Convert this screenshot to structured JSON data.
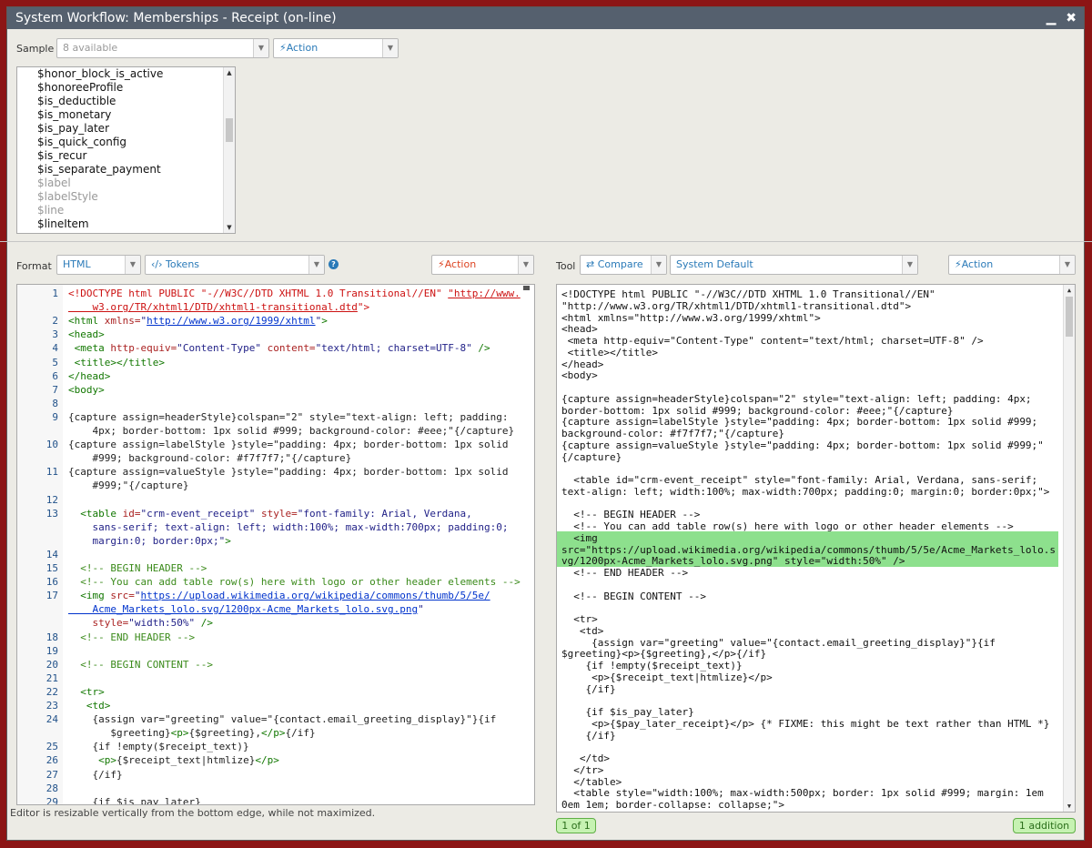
{
  "title": "System Workflow: Memberships - Receipt (on-line)",
  "window_buttons": {
    "minimize": "▁",
    "close": "✖"
  },
  "sample": {
    "label": "Sample",
    "select_value": "8 available",
    "action_label": "⚡Action"
  },
  "tokens": [
    {
      "text": "$honor_block_is_active",
      "dim": false
    },
    {
      "text": "$honoreeProfile",
      "dim": false
    },
    {
      "text": "$is_deductible",
      "dim": false
    },
    {
      "text": "$is_monetary",
      "dim": false
    },
    {
      "text": "$is_pay_later",
      "dim": false
    },
    {
      "text": "$is_quick_config",
      "dim": false
    },
    {
      "text": "$is_recur",
      "dim": false
    },
    {
      "text": "$is_separate_payment",
      "dim": false
    },
    {
      "text": "$label",
      "dim": true
    },
    {
      "text": "$labelStyle",
      "dim": true
    },
    {
      "text": "$line",
      "dim": true
    },
    {
      "text": "$lineItem",
      "dim": false
    }
  ],
  "format": {
    "label": "Format",
    "format_value": "HTML",
    "tokens_label": "‹/› Tokens",
    "help": "?",
    "action_label": "⚡Action"
  },
  "tool": {
    "label": "Tool",
    "compare_label": "⇄ Compare",
    "default_label": "System Default",
    "action_label": "⚡Action"
  },
  "editor_lines": [
    {
      "n": "1",
      "html": "<span class='red'>&lt;!DOCTYPE html PUBLIC \"-//W3C//DTD XHTML 1.0 Transitional//EN\" </span><span class='url red'>\"http://www.</span>"
    },
    {
      "n": "",
      "html": "<span class='url red'>    w3.org/TR/xhtml1/DTD/xhtml1-transitional.dtd</span><span class='red'>\"&gt;</span>"
    },
    {
      "n": "2",
      "html": "<span class='tag'>&lt;html</span> <span class='att'>xmlns=</span><span class='str'>\"<span class='url'>http://www.w3.org/1999/xhtml</span>\"</span><span class='tag'>&gt;</span>"
    },
    {
      "n": "3",
      "html": "<span class='tag'>&lt;head&gt;</span>"
    },
    {
      "n": "4",
      "html": " <span class='tag'>&lt;meta</span> <span class='att'>http-equiv=</span><span class='str'>\"Content-Type\"</span> <span class='att'>content=</span><span class='str'>\"text/html; charset=UTF-8\"</span> <span class='tag'>/&gt;</span>"
    },
    {
      "n": "5",
      "html": " <span class='tag'>&lt;title&gt;&lt;/title&gt;</span>"
    },
    {
      "n": "6",
      "html": "<span class='tag'>&lt;/head&gt;</span>"
    },
    {
      "n": "7",
      "html": "<span class='tag'>&lt;body&gt;</span>"
    },
    {
      "n": "8",
      "html": ""
    },
    {
      "n": "9",
      "html": "{capture assign=headerStyle}colspan=\"2\" style=\"text-align: left; padding:"
    },
    {
      "n": "",
      "html": "    4px; border-bottom: 1px solid #999; background-color: #eee;\"{/capture}"
    },
    {
      "n": "10",
      "html": "{capture assign=labelStyle }style=\"padding: 4px; border-bottom: 1px solid"
    },
    {
      "n": "",
      "html": "    #999; background-color: #f7f7f7;\"{/capture}"
    },
    {
      "n": "11",
      "html": "{capture assign=valueStyle }style=\"padding: 4px; border-bottom: 1px solid"
    },
    {
      "n": "",
      "html": "    #999;\"{/capture}"
    },
    {
      "n": "12",
      "html": ""
    },
    {
      "n": "13",
      "html": "  <span class='tag'>&lt;table</span> <span class='att'>id=</span><span class='str'>\"crm-event_receipt\"</span> <span class='att'>style=</span><span class='str'>\"font-family: Arial, Verdana,</span>"
    },
    {
      "n": "",
      "html": "<span class='str'>    sans-serif; text-align: left; width:100%; max-width:700px; padding:0;</span>"
    },
    {
      "n": "",
      "html": "<span class='str'>    margin:0; border:0px;\"</span><span class='tag'>&gt;</span>"
    },
    {
      "n": "14",
      "html": ""
    },
    {
      "n": "15",
      "html": "  <span class='cmt'>&lt;!-- BEGIN HEADER --&gt;</span>"
    },
    {
      "n": "16",
      "html": "  <span class='cmt'>&lt;!-- You can add table row(s) here with logo or other header elements --&gt;</span>"
    },
    {
      "n": "17",
      "html": "  <span class='tag'>&lt;img</span> <span class='att'>src=</span><span class='str'>\"<span class='url'>https://upload.wikimedia.org/wikipedia/commons/thumb/5/5e/</span></span>"
    },
    {
      "n": "",
      "html": "<span class='str'><span class='url'>    Acme_Markets_lolo.svg/1200px-Acme_Markets_lolo.svg.png</span>\"</span>"
    },
    {
      "n": "",
      "html": "    <span class='att'>style=</span><span class='str'>\"width:50%\"</span> <span class='tag'>/&gt;</span>"
    },
    {
      "n": "18",
      "html": "  <span class='cmt'>&lt;!-- END HEADER --&gt;</span>"
    },
    {
      "n": "19",
      "html": ""
    },
    {
      "n": "20",
      "html": "  <span class='cmt'>&lt;!-- BEGIN CONTENT --&gt;</span>"
    },
    {
      "n": "21",
      "html": ""
    },
    {
      "n": "22",
      "html": "  <span class='tag'>&lt;tr&gt;</span>"
    },
    {
      "n": "23",
      "html": "   <span class='tag'>&lt;td&gt;</span>"
    },
    {
      "n": "24",
      "html": "    {assign var=\"greeting\" value=\"{contact.email_greeting_display}\"}{if"
    },
    {
      "n": "",
      "html": "       $greeting}<span class='tag'>&lt;p&gt;</span>{$greeting},<span class='tag'>&lt;/p&gt;</span>{/if}"
    },
    {
      "n": "25",
      "html": "    {if !empty($receipt_text)}"
    },
    {
      "n": "26",
      "html": "     <span class='tag'>&lt;p&gt;</span>{$receipt_text|htmlize}<span class='tag'>&lt;/p&gt;</span>"
    },
    {
      "n": "27",
      "html": "    {/if}"
    },
    {
      "n": "28",
      "html": ""
    },
    {
      "n": "29",
      "html": "    {if $is_pay_later}"
    }
  ],
  "compare_lines": [
    "<!DOCTYPE html PUBLIC \"-//W3C//DTD XHTML 1.0 Transitional//EN\"",
    "\"http://www.w3.org/TR/xhtml1/DTD/xhtml1-transitional.dtd\">",
    "<html xmlns=\"http://www.w3.org/1999/xhtml\">",
    "<head>",
    " <meta http-equiv=\"Content-Type\" content=\"text/html; charset=UTF-8\" />",
    " <title></title>",
    "</head>",
    "<body>",
    "",
    "{capture assign=headerStyle}colspan=\"2\" style=\"text-align: left; padding: 4px;",
    "border-bottom: 1px solid #999; background-color: #eee;\"{/capture}",
    "{capture assign=labelStyle }style=\"padding: 4px; border-bottom: 1px solid #999;",
    "background-color: #f7f7f7;\"{/capture}",
    "{capture assign=valueStyle }style=\"padding: 4px; border-bottom: 1px solid #999;\"",
    "{/capture}",
    "",
    "  <table id=\"crm-event_receipt\" style=\"font-family: Arial, Verdana, sans-serif;",
    "text-align: left; width:100%; max-width:700px; padding:0; margin:0; border:0px;\">",
    "",
    "  <!-- BEGIN HEADER -->",
    "  <!-- You can add table row(s) here with logo or other header elements -->",
    "  <img",
    "src=\"https://upload.wikimedia.org/wikipedia/commons/thumb/5/5e/Acme_Markets_lolo.s",
    "vg/1200px-Acme_Markets_lolo.svg.png\" style=\"width:50%\" />",
    "  <!-- END HEADER -->",
    "",
    "  <!-- BEGIN CONTENT -->",
    "",
    "  <tr>",
    "   <td>",
    "     {assign var=\"greeting\" value=\"{contact.email_greeting_display}\"}{if",
    "$greeting}<p>{$greeting},</p>{/if}",
    "    {if !empty($receipt_text)}",
    "     <p>{$receipt_text|htmlize}</p>",
    "    {/if}",
    "",
    "    {if $is_pay_later}",
    "     <p>{$pay_later_receipt}</p> {* FIXME: this might be text rather than HTML *}",
    "    {/if}",
    "",
    "   </td>",
    "  </tr>",
    "  </table>",
    "  <table style=\"width:100%; max-width:500px; border: 1px solid #999; margin: 1em",
    "0em 1em; border-collapse: collapse;\">"
  ],
  "footer": {
    "note": "Editor is resizable vertically from the bottom edge, while not maximized.",
    "pager": "1 of 1",
    "diff_count": "1 addition"
  }
}
